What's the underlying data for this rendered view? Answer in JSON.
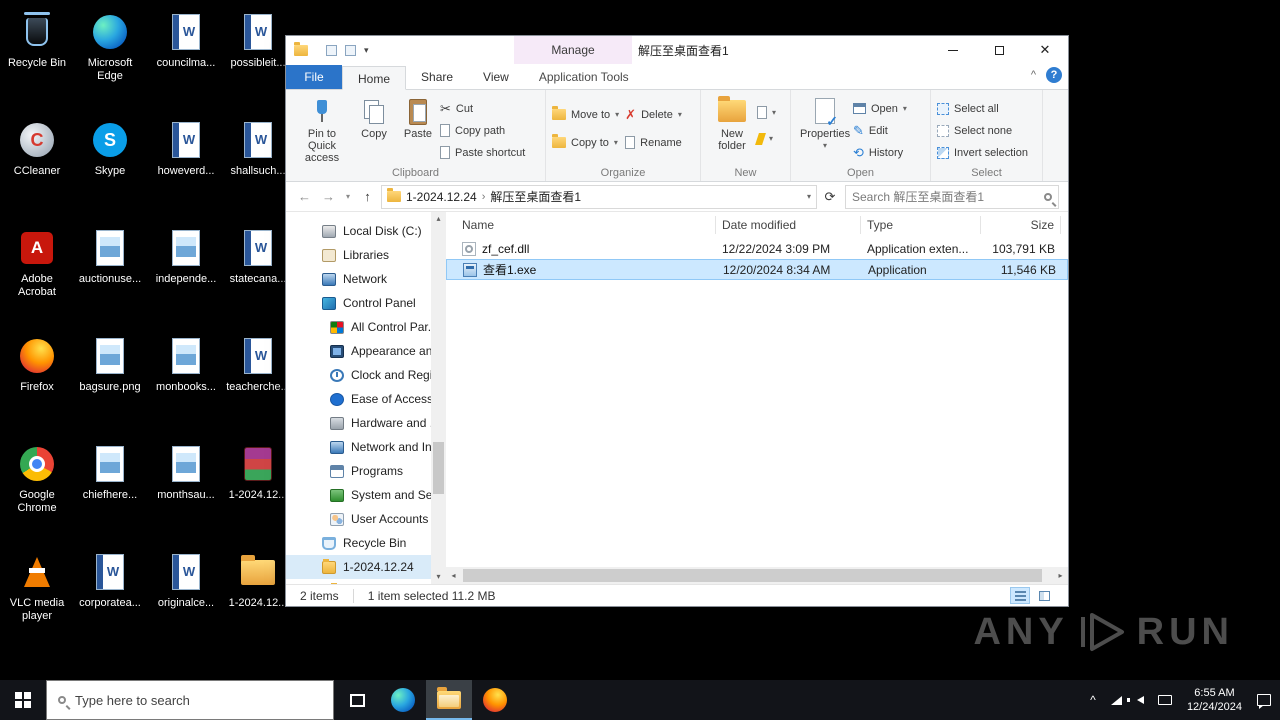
{
  "desktop": {
    "icons": [
      {
        "label": "Recycle Bin"
      },
      {
        "label": "Microsoft Edge"
      },
      {
        "label": "councilma..."
      },
      {
        "label": "possibleit..."
      },
      {
        "label": "CCleaner"
      },
      {
        "label": "Skype"
      },
      {
        "label": "howeverd..."
      },
      {
        "label": "shallsuch..."
      },
      {
        "label": "Adobe Acrobat"
      },
      {
        "label": "auctionuse..."
      },
      {
        "label": "independe..."
      },
      {
        "label": "statecana..."
      },
      {
        "label": "Firefox"
      },
      {
        "label": "bagsure.png"
      },
      {
        "label": "monbooks..."
      },
      {
        "label": "teacherche..."
      },
      {
        "label": "Google Chrome"
      },
      {
        "label": "chiefhere..."
      },
      {
        "label": "monthsau..."
      },
      {
        "label": "1-2024.12..."
      },
      {
        "label": "VLC media player"
      },
      {
        "label": "corporatea..."
      },
      {
        "label": "originalce..."
      },
      {
        "label": "1-2024.12..."
      }
    ]
  },
  "window": {
    "title": "解压至桌面查看1",
    "contextual": {
      "header": "Manage",
      "tab": "Application Tools"
    },
    "tabs": {
      "file": "File",
      "home": "Home",
      "share": "Share",
      "view": "View"
    },
    "ribbon": {
      "pin": "Pin to Quick access",
      "copy": "Copy",
      "paste": "Paste",
      "cut": "Cut",
      "copy_path": "Copy path",
      "paste_shortcut": "Paste shortcut",
      "move_to": "Move to",
      "copy_to": "Copy to",
      "delete": "Delete",
      "rename": "Rename",
      "new_folder": "New folder",
      "properties": "Properties",
      "open": "Open",
      "edit": "Edit",
      "history": "History",
      "select_all": "Select all",
      "select_none": "Select none",
      "invert": "Invert selection",
      "groups": {
        "clipboard": "Clipboard",
        "organize": "Organize",
        "new": "New",
        "open": "Open",
        "select": "Select"
      }
    },
    "address": {
      "crumb1": "1-2024.12.24",
      "crumb2": "解压至桌面查看1",
      "search": "Search 解压至桌面查看1"
    },
    "nav": {
      "items": [
        {
          "label": "Local Disk (C:)"
        },
        {
          "label": "Libraries"
        },
        {
          "label": "Network"
        },
        {
          "label": "Control Panel"
        },
        {
          "label": "All Control Par..."
        },
        {
          "label": "Appearance an..."
        },
        {
          "label": "Clock and Regi..."
        },
        {
          "label": "Ease of Access"
        },
        {
          "label": "Hardware and ..."
        },
        {
          "label": "Network and In..."
        },
        {
          "label": "Programs"
        },
        {
          "label": "System and Se..."
        },
        {
          "label": "User Accounts"
        },
        {
          "label": "Recycle Bin"
        },
        {
          "label": "1-2024.12.24"
        },
        {
          "label": ""
        }
      ]
    },
    "list": {
      "columns": {
        "name": "Name",
        "modified": "Date modified",
        "type": "Type",
        "size": "Size"
      },
      "rows": [
        {
          "name": "zf_cef.dll",
          "modified": "12/22/2024 3:09 PM",
          "type": "Application exten...",
          "size": "103,791 KB"
        },
        {
          "name": "查看1.exe",
          "modified": "12/20/2024 8:34 AM",
          "type": "Application",
          "size": "11,546 KB"
        }
      ]
    },
    "status": {
      "count": "2 items",
      "selection": "1 item selected 11.2 MB"
    }
  },
  "watermark": {
    "any": "ANY",
    "run": "RUN"
  },
  "taskbar": {
    "search": "Type here to search",
    "time": "6:55 AM",
    "date": "12/24/2024"
  },
  "glyphs": {
    "back": "←",
    "forward": "→",
    "up": "↑",
    "dropdown": "▾",
    "refresh": "⟳",
    "sep": "›",
    "cut": "✂",
    "delete": "✗",
    "pencil": "✎",
    "history": "⟲",
    "close": "✕",
    "help": "?",
    "chevron_up": "^",
    "scroll_up": "▴",
    "scroll_down": "▾",
    "scroll_left": "◂",
    "scroll_right": "▸"
  }
}
